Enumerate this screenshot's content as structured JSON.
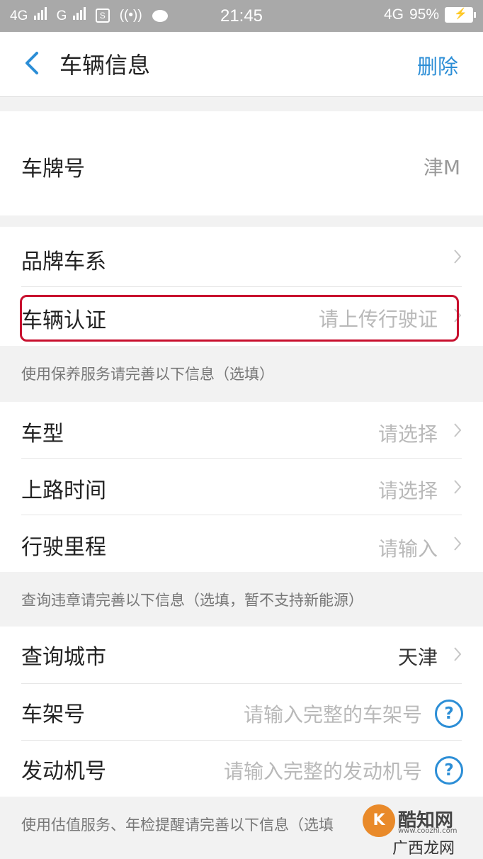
{
  "status_bar": {
    "network1": "4G",
    "network2": "G",
    "sim_icon_text": "S",
    "time": "21:45",
    "network3": "4G",
    "battery": "95%"
  },
  "navbar": {
    "title": "车辆信息",
    "action": "删除",
    "accent_color": "#2c8ed6"
  },
  "fields": {
    "plate": {
      "label": "车牌号",
      "value": "津M"
    },
    "brand": {
      "label": "品牌车系",
      "value": ""
    },
    "certification": {
      "label": "车辆认证",
      "value": "请上传行驶证"
    },
    "model": {
      "label": "车型",
      "value": "请选择"
    },
    "registration_date": {
      "label": "上路时间",
      "value": "请选择"
    },
    "mileage": {
      "label": "行驶里程",
      "value": "请输入"
    },
    "city": {
      "label": "查询城市",
      "value": "天津"
    },
    "vin": {
      "label": "车架号",
      "placeholder": "请输入完整的车架号"
    },
    "engine": {
      "label": "发动机号",
      "placeholder": "请输入完整的发动机号"
    }
  },
  "sections": {
    "maintenance_note": "使用保养服务请完善以下信息（选填）",
    "violation_note": "查询违章请完善以下信息（选填，暂不支持新能源）",
    "valuation_note": "使用估值服务、年检提醒请完善以下信息（选填"
  },
  "help_icon_glyph": "?",
  "watermark": {
    "logo_text": "K",
    "name": "酷知网",
    "url": "www.coozhi.com",
    "sub": "广西龙网"
  },
  "highlight_color": "#c8102e"
}
